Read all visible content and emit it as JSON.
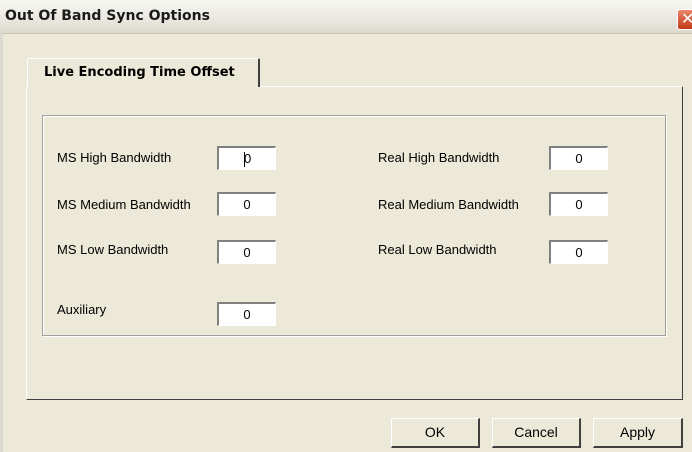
{
  "window": {
    "title": "Out Of Band Sync Options"
  },
  "tabs": [
    {
      "label": "Live Encoding Time Offset",
      "selected": true
    }
  ],
  "fields": {
    "ms_high": {
      "label": "MS High Bandwidth",
      "value": "0"
    },
    "ms_medium": {
      "label": "MS Medium Bandwidth",
      "value": "0"
    },
    "ms_low": {
      "label": "MS Low Bandwidth",
      "value": "0"
    },
    "auxiliary": {
      "label": "Auxiliary",
      "value": "0"
    },
    "real_high": {
      "label": "Real High Bandwidth",
      "value": "0"
    },
    "real_medium": {
      "label": "Real Medium Bandwidth",
      "value": "0"
    },
    "real_low": {
      "label": "Real Low Bandwidth",
      "value": "0"
    }
  },
  "buttons": {
    "ok": "OK",
    "cancel": "Cancel",
    "apply": "Apply"
  },
  "icons": {
    "close": "close-icon"
  },
  "colors": {
    "dialog_bg": "#ece9d8",
    "close_button": "#c3391a"
  }
}
